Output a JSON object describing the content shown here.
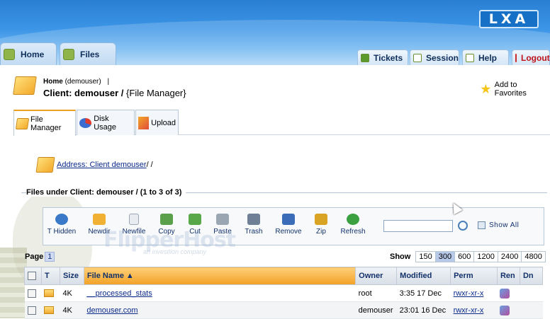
{
  "header": {
    "logo": "LXA",
    "main_tabs": [
      {
        "label": "Home"
      },
      {
        "label": "Files"
      }
    ],
    "right_tabs": [
      {
        "label": "Tickets"
      },
      {
        "label": "Session"
      },
      {
        "label": "Help"
      },
      {
        "label": "Logout"
      }
    ]
  },
  "page": {
    "breadcrumb_home": "Home",
    "breadcrumb_user": "(demouser)",
    "breadcrumb_sep": "|",
    "title": "Client: demouser /",
    "title_section": "{File Manager}",
    "favorites": "Add to Favorites"
  },
  "subtabs": [
    {
      "label": "File Manager",
      "active": true
    },
    {
      "label": "Disk Usage",
      "active": false
    },
    {
      "label": "Upload",
      "active": false
    }
  ],
  "address": {
    "link": "Address: Client demouser",
    "trail": "/ /"
  },
  "files_under": "Files under Client: demouser / (1 to 3 of 3)",
  "toolbar": [
    {
      "label": "T Hidden",
      "icon": "hidden-toggle-icon",
      "color": "#3a78c8"
    },
    {
      "label": "Newdir",
      "icon": "new-folder-icon",
      "color": "#f0b032"
    },
    {
      "label": "Newfile",
      "icon": "new-file-icon",
      "color": "#e8ecf0"
    },
    {
      "label": "Copy",
      "icon": "copy-icon",
      "color": "#5aa04a"
    },
    {
      "label": "Cut",
      "icon": "cut-icon",
      "color": "#58a84a"
    },
    {
      "label": "Paste",
      "icon": "paste-icon",
      "color": "#9aa6b2"
    },
    {
      "label": "Trash",
      "icon": "trash-icon",
      "color": "#6e7f96"
    },
    {
      "label": "Remove",
      "icon": "remove-icon",
      "color": "#3a6cb8"
    },
    {
      "label": "Zip",
      "icon": "zip-icon",
      "color": "#d9a424"
    },
    {
      "label": "Refresh",
      "icon": "refresh-icon",
      "color": "#3aa040"
    }
  ],
  "search": {
    "placeholder": "",
    "show_all": "Show All"
  },
  "watermark": {
    "brand": "FlipperHost",
    "tagline": "an investlion company"
  },
  "pager": {
    "label": "Page",
    "current": "1"
  },
  "show": {
    "label": "Show",
    "options": [
      "150",
      "300",
      "600",
      "1200",
      "2400",
      "4800"
    ],
    "selected": "300"
  },
  "table": {
    "columns": [
      "T",
      "Size",
      "File Name ▲",
      "Owner",
      "Modified",
      "Perm",
      "Ren",
      "Dn"
    ],
    "rows": [
      {
        "size": "4K",
        "name": "__processed_stats",
        "owner": "root",
        "modified": "3:35 17 Dec",
        "perm": "rwxr-xr-x"
      },
      {
        "size": "4K",
        "name": "demouser.com",
        "owner": "demouser",
        "modified": "23:01 16 Dec",
        "perm": "rwxr-xr-x"
      }
    ]
  },
  "colors": {
    "header_blue": "#2a7fd3",
    "sort_orange": "#f2a125",
    "link_blue": "#0b2a8a",
    "logout_red": "#c0121b"
  }
}
